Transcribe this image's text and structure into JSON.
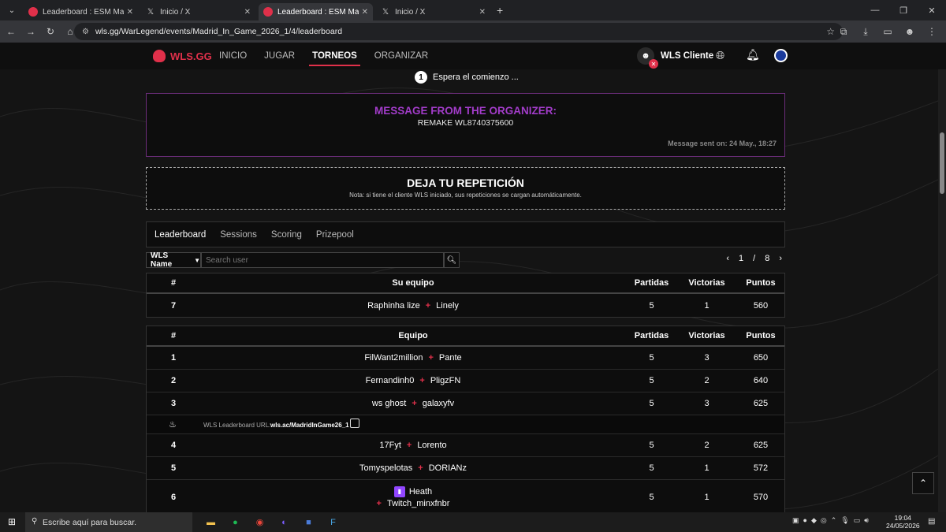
{
  "browser": {
    "tabs": [
      {
        "title": "Leaderboard : ESM Madrid In G",
        "icon": "wls-icon",
        "active": false
      },
      {
        "title": "Inicio / X",
        "icon": "x-icon",
        "active": false
      },
      {
        "title": "Leaderboard : ESM Madrid In G",
        "icon": "wls-icon",
        "active": true
      },
      {
        "title": "Inicio / X",
        "icon": "x-icon",
        "active": false
      }
    ],
    "url": "wls.gg/WarLegend/events/Madrid_In_Game_2026_1/4/leaderboard"
  },
  "site": {
    "logo": "WLS.GG",
    "nav": [
      "INICIO",
      "JUGAR",
      "TORNEOS",
      "ORGANIZAR"
    ],
    "active_nav": "TORNEOS",
    "client_label": "WLS Cliente",
    "accent": "#e0304a"
  },
  "step": {
    "number": "1",
    "text": "Espera el comienzo ..."
  },
  "organizer_message": {
    "title": "MESSAGE FROM THE ORGANIZER:",
    "text": "REMAKE WL8740375600",
    "date": "Message sent on: 24 May., 18:27",
    "title_color": "#a23cc9"
  },
  "replay": {
    "title": "DEJA TU REPETICIÓN",
    "note": "Nota: si tiene el cliente WLS iniciado, sus repeticiones se cargan automáticamente."
  },
  "leaderboard_tabs": [
    "Leaderboard",
    "Sessions",
    "Scoring",
    "Prizepool"
  ],
  "filter": {
    "select_value": "WLS Name",
    "search_placeholder": "Search user",
    "page_current": "1",
    "page_sep": "/",
    "page_total": "8"
  },
  "my_team": {
    "headers": {
      "rank": "#",
      "team": "Su equipo",
      "games": "Partidas",
      "wins": "Victorias",
      "points": "Puntos"
    },
    "row": {
      "rank": "7",
      "p1": "Raphinha lize",
      "p2": "Linely",
      "games": "5",
      "wins": "1",
      "points": "560"
    }
  },
  "standings": {
    "headers": {
      "rank": "#",
      "team": "Equipo",
      "games": "Partidas",
      "wins": "Victorias",
      "points": "Puntos"
    },
    "rows": [
      {
        "rank": "1",
        "p1": "FilWant2million",
        "p2": "Pante",
        "games": "5",
        "wins": "3",
        "points": "650"
      },
      {
        "rank": "2",
        "p1": "Fernandinh0",
        "p2": "PligzFN",
        "games": "5",
        "wins": "2",
        "points": "640"
      },
      {
        "rank": "3",
        "p1": "ws ghost",
        "p2": "galaxyfv",
        "games": "5",
        "wins": "3",
        "points": "625"
      },
      {
        "rank": "4",
        "p1": "17Fyt",
        "p2": "Lorento",
        "games": "5",
        "wins": "2",
        "points": "625"
      },
      {
        "rank": "5",
        "p1": "Tomyspelotas",
        "p2": "DORIANz",
        "games": "5",
        "wins": "1",
        "points": "572"
      },
      {
        "rank": "6",
        "p1": "Heath",
        "p2": "Twitch_minxfnbr",
        "games": "5",
        "wins": "1",
        "points": "570"
      }
    ],
    "url_label": "WLS Leaderboard URL:",
    "url_value": "wls.ac/MadridInGame26_1"
  },
  "taskbar": {
    "search_placeholder": "Escribe aquí para buscar.",
    "time": "19:04",
    "date": "24/05/2026"
  }
}
